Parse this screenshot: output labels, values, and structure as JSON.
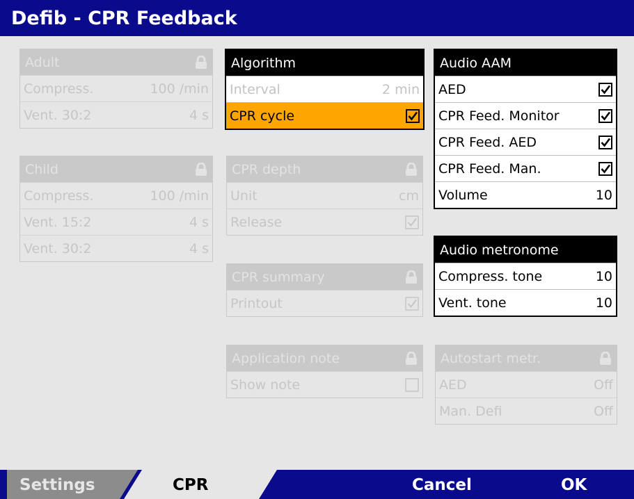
{
  "window": {
    "title": "Defib - CPR Feedback"
  },
  "adult": {
    "title": "Adult",
    "rows": [
      {
        "label": "Compress.",
        "value": "100 /min"
      },
      {
        "label": "Vent. 30:2",
        "value": "4 s"
      }
    ]
  },
  "child": {
    "title": "Child",
    "rows": [
      {
        "label": "Compress.",
        "value": "100 /min"
      },
      {
        "label": "Vent. 15:2",
        "value": "4 s"
      },
      {
        "label": "Vent. 30:2",
        "value": "4 s"
      }
    ]
  },
  "algorithm": {
    "title": "Algorithm",
    "rows": [
      {
        "label": "Interval",
        "value": "2 min"
      },
      {
        "label": "CPR cycle",
        "checked": true
      }
    ]
  },
  "cpr_depth": {
    "title": "CPR depth",
    "rows": [
      {
        "label": "Unit",
        "value": "cm"
      },
      {
        "label": "Release",
        "checked": true
      }
    ]
  },
  "cpr_summary": {
    "title": "CPR summary",
    "rows": [
      {
        "label": "Printout",
        "checked": true
      }
    ]
  },
  "application_note": {
    "title": "Application note",
    "rows": [
      {
        "label": "Show note",
        "checked": false
      }
    ]
  },
  "audio_aam": {
    "title": "Audio AAM",
    "rows": [
      {
        "label": "AED",
        "checked": true
      },
      {
        "label": "CPR Feed. Monitor",
        "checked": true
      },
      {
        "label": "CPR Feed. AED",
        "checked": true
      },
      {
        "label": "CPR Feed. Man.",
        "checked": true
      },
      {
        "label": "Volume",
        "value": "10"
      }
    ]
  },
  "audio_metronome": {
    "title": "Audio metronome",
    "rows": [
      {
        "label": "Compress. tone",
        "value": "10"
      },
      {
        "label": "Vent. tone",
        "value": "10"
      }
    ]
  },
  "autostart": {
    "title": "Autostart metr.",
    "rows": [
      {
        "label": "AED",
        "value": "Off"
      },
      {
        "label": "Man. Defi",
        "value": "Off"
      }
    ]
  },
  "bottom": {
    "settings_label": "Settings",
    "cpr_label": "CPR",
    "cancel_label": "Cancel",
    "ok_label": "OK"
  },
  "colors": {
    "title_bar": "#0a0a8c",
    "selected_row": "#ffa500",
    "disabled_header": "#c9c9c9",
    "tab_inactive": "#8c8c8c"
  }
}
